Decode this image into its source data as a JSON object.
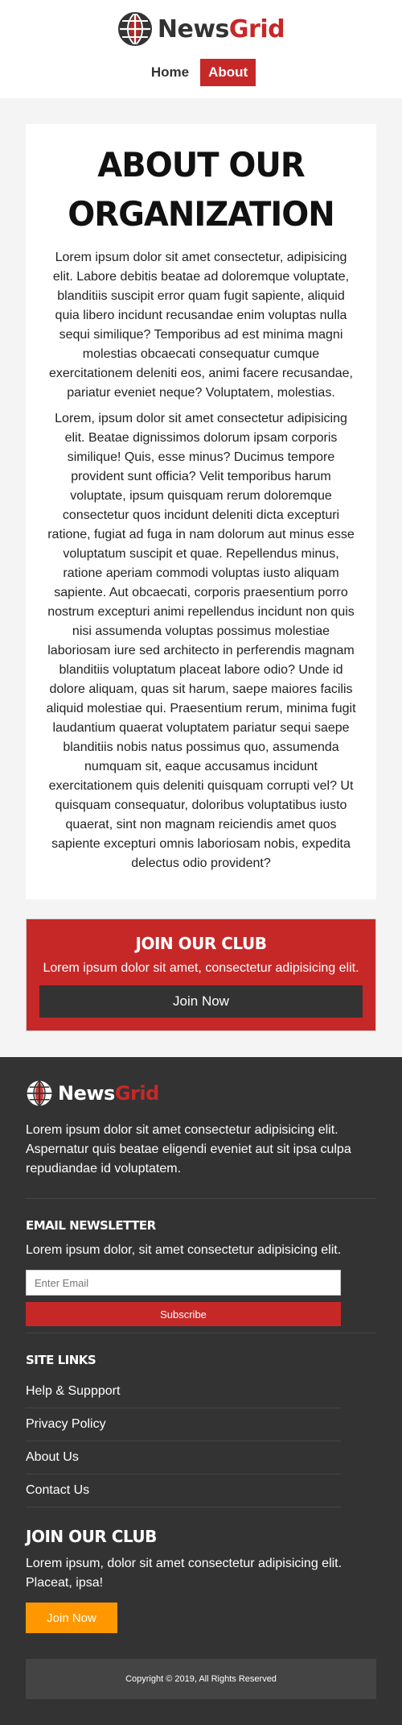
{
  "header": {
    "logo_text_dark": "News",
    "logo_text_red": "Grid",
    "logo_icon": "globe-icon",
    "nav": [
      {
        "label": "Home"
      },
      {
        "label": "About"
      }
    ]
  },
  "article": {
    "title": "About Our Organization",
    "paragraphs": [
      "Lorem ipsum dolor sit amet consectetur, adipisicing elit. Labore debitis beatae ad doloremque voluptate, blanditiis suscipit error quam fugit sapiente, aliquid quia libero incidunt recusandae enim voluptas nulla sequi similique? Temporibus ad est minima magni molestias obcaecati consequatur cumque exercitationem deleniti eos, animi facere recusandae, pariatur eveniet neque? Voluptatem, molestias.",
      "Lorem, ipsum dolor sit amet consectetur adipisicing elit. Beatae dignissimos dolorum ipsam corporis similique! Quis, esse minus? Ducimus tempore provident sunt officia? Velit temporibus harum voluptate, ipsum quisquam rerum doloremque consectetur quos incidunt deleniti dicta excepturi ratione, fugiat ad fuga in nam dolorum aut minus esse voluptatum suscipit et quae. Repellendus minus, ratione aperiam commodi voluptas iusto aliquam sapiente. Aut obcaecati, corporis praesentium porro nostrum excepturi animi repellendus incidunt non quis nisi assumenda voluptas possimus molestiae laboriosam iure sed architecto in perferendis magnam blanditiis voluptatum placeat labore odio? Unde id dolore aliquam, quas sit harum, saepe maiores facilis aliquid molestiae qui. Praesentium rerum, minima fugit laudantium quaerat voluptatem pariatur sequi saepe blanditiis nobis natus possimus quo, assumenda numquam sit, eaque accusamus incidunt exercitationem quis deleniti quisquam corrupti vel? Ut quisquam consequatur, doloribus voluptatibus iusto quaerat, sint non magnam reiciendis amet quos sapiente excepturi omnis laboriosam nobis, expedita delectus odio provident?"
    ]
  },
  "club": {
    "title": "Join Our Club",
    "text": "Lorem ipsum dolor sit amet, consectetur adipisicing elit.",
    "button": "Join Now"
  },
  "footer": {
    "logo_text_light": "News",
    "logo_text_red": "Grid",
    "about": "Lorem ipsum dolor sit amet consectetur adipisicing elit. Aspernatur quis beatae eligendi eveniet aut sit ipsa culpa repudiandae id voluptatem.",
    "newsletter": {
      "title": "Email Newsletter",
      "text": "Lorem ipsum dolor, sit amet consectetur adipisicing elit.",
      "placeholder": "Enter Email",
      "button": "Subscribe"
    },
    "site_links": {
      "title": "Site Links",
      "items": [
        "Help & Suppport",
        "Privacy Policy",
        "About Us",
        "Contact Us"
      ]
    },
    "club": {
      "title": "Join Our Club",
      "text": "Lorem ipsum, dolor sit amet consectetur adipisicing elit. Placeat, ipsa!",
      "button": "Join Now"
    },
    "copyright": "Copyright © 2019, All Rights Reserved"
  },
  "colors": {
    "brand_red": "#c62828",
    "dark": "#333333",
    "orange": "#ff9800"
  }
}
